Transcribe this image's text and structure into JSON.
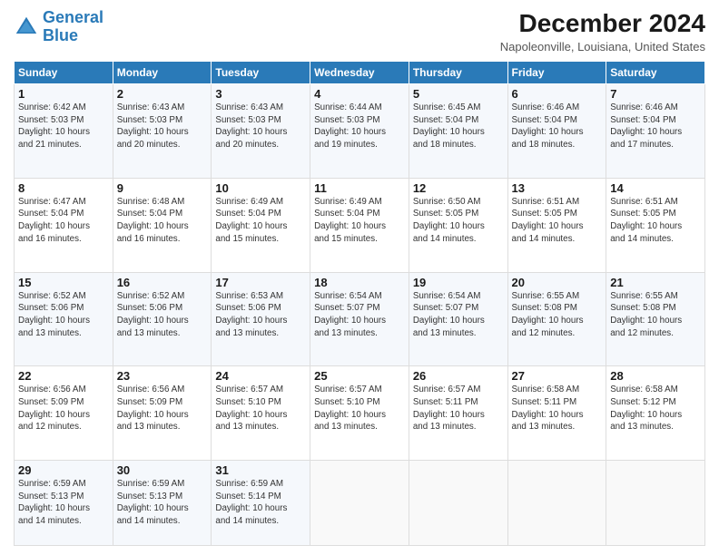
{
  "logo": {
    "line1": "General",
    "line2": "Blue"
  },
  "title": "December 2024",
  "location": "Napoleonville, Louisiana, United States",
  "headers": [
    "Sunday",
    "Monday",
    "Tuesday",
    "Wednesday",
    "Thursday",
    "Friday",
    "Saturday"
  ],
  "weeks": [
    [
      {
        "day": "1",
        "info": "Sunrise: 6:42 AM\nSunset: 5:03 PM\nDaylight: 10 hours\nand 21 minutes."
      },
      {
        "day": "2",
        "info": "Sunrise: 6:43 AM\nSunset: 5:03 PM\nDaylight: 10 hours\nand 20 minutes."
      },
      {
        "day": "3",
        "info": "Sunrise: 6:43 AM\nSunset: 5:03 PM\nDaylight: 10 hours\nand 20 minutes."
      },
      {
        "day": "4",
        "info": "Sunrise: 6:44 AM\nSunset: 5:03 PM\nDaylight: 10 hours\nand 19 minutes."
      },
      {
        "day": "5",
        "info": "Sunrise: 6:45 AM\nSunset: 5:04 PM\nDaylight: 10 hours\nand 18 minutes."
      },
      {
        "day": "6",
        "info": "Sunrise: 6:46 AM\nSunset: 5:04 PM\nDaylight: 10 hours\nand 18 minutes."
      },
      {
        "day": "7",
        "info": "Sunrise: 6:46 AM\nSunset: 5:04 PM\nDaylight: 10 hours\nand 17 minutes."
      }
    ],
    [
      {
        "day": "8",
        "info": "Sunrise: 6:47 AM\nSunset: 5:04 PM\nDaylight: 10 hours\nand 16 minutes."
      },
      {
        "day": "9",
        "info": "Sunrise: 6:48 AM\nSunset: 5:04 PM\nDaylight: 10 hours\nand 16 minutes."
      },
      {
        "day": "10",
        "info": "Sunrise: 6:49 AM\nSunset: 5:04 PM\nDaylight: 10 hours\nand 15 minutes."
      },
      {
        "day": "11",
        "info": "Sunrise: 6:49 AM\nSunset: 5:04 PM\nDaylight: 10 hours\nand 15 minutes."
      },
      {
        "day": "12",
        "info": "Sunrise: 6:50 AM\nSunset: 5:05 PM\nDaylight: 10 hours\nand 14 minutes."
      },
      {
        "day": "13",
        "info": "Sunrise: 6:51 AM\nSunset: 5:05 PM\nDaylight: 10 hours\nand 14 minutes."
      },
      {
        "day": "14",
        "info": "Sunrise: 6:51 AM\nSunset: 5:05 PM\nDaylight: 10 hours\nand 14 minutes."
      }
    ],
    [
      {
        "day": "15",
        "info": "Sunrise: 6:52 AM\nSunset: 5:06 PM\nDaylight: 10 hours\nand 13 minutes."
      },
      {
        "day": "16",
        "info": "Sunrise: 6:52 AM\nSunset: 5:06 PM\nDaylight: 10 hours\nand 13 minutes."
      },
      {
        "day": "17",
        "info": "Sunrise: 6:53 AM\nSunset: 5:06 PM\nDaylight: 10 hours\nand 13 minutes."
      },
      {
        "day": "18",
        "info": "Sunrise: 6:54 AM\nSunset: 5:07 PM\nDaylight: 10 hours\nand 13 minutes."
      },
      {
        "day": "19",
        "info": "Sunrise: 6:54 AM\nSunset: 5:07 PM\nDaylight: 10 hours\nand 13 minutes."
      },
      {
        "day": "20",
        "info": "Sunrise: 6:55 AM\nSunset: 5:08 PM\nDaylight: 10 hours\nand 12 minutes."
      },
      {
        "day": "21",
        "info": "Sunrise: 6:55 AM\nSunset: 5:08 PM\nDaylight: 10 hours\nand 12 minutes."
      }
    ],
    [
      {
        "day": "22",
        "info": "Sunrise: 6:56 AM\nSunset: 5:09 PM\nDaylight: 10 hours\nand 12 minutes."
      },
      {
        "day": "23",
        "info": "Sunrise: 6:56 AM\nSunset: 5:09 PM\nDaylight: 10 hours\nand 13 minutes."
      },
      {
        "day": "24",
        "info": "Sunrise: 6:57 AM\nSunset: 5:10 PM\nDaylight: 10 hours\nand 13 minutes."
      },
      {
        "day": "25",
        "info": "Sunrise: 6:57 AM\nSunset: 5:10 PM\nDaylight: 10 hours\nand 13 minutes."
      },
      {
        "day": "26",
        "info": "Sunrise: 6:57 AM\nSunset: 5:11 PM\nDaylight: 10 hours\nand 13 minutes."
      },
      {
        "day": "27",
        "info": "Sunrise: 6:58 AM\nSunset: 5:11 PM\nDaylight: 10 hours\nand 13 minutes."
      },
      {
        "day": "28",
        "info": "Sunrise: 6:58 AM\nSunset: 5:12 PM\nDaylight: 10 hours\nand 13 minutes."
      }
    ],
    [
      {
        "day": "29",
        "info": "Sunrise: 6:59 AM\nSunset: 5:13 PM\nDaylight: 10 hours\nand 14 minutes."
      },
      {
        "day": "30",
        "info": "Sunrise: 6:59 AM\nSunset: 5:13 PM\nDaylight: 10 hours\nand 14 minutes."
      },
      {
        "day": "31",
        "info": "Sunrise: 6:59 AM\nSunset: 5:14 PM\nDaylight: 10 hours\nand 14 minutes."
      },
      {
        "day": "",
        "info": ""
      },
      {
        "day": "",
        "info": ""
      },
      {
        "day": "",
        "info": ""
      },
      {
        "day": "",
        "info": ""
      }
    ]
  ]
}
